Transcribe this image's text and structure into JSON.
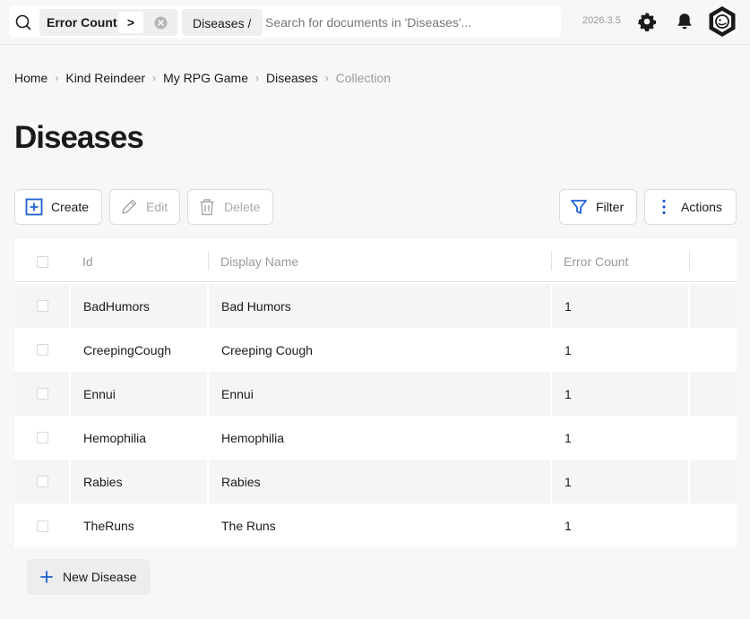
{
  "search": {
    "filter_field": "Error Count",
    "filter_operator": ">",
    "collection_chip": "Diseases /",
    "placeholder": "Search for documents in 'Diseases'..."
  },
  "header": {
    "version": "2026.3.5",
    "icons": [
      "search-icon",
      "clear-filter-icon",
      "settings-icon",
      "bell-icon",
      "avatar-icon"
    ]
  },
  "breadcrumb": [
    "Home",
    "Kind Reindeer",
    "My RPG Game",
    "Diseases",
    "Collection"
  ],
  "page_title": "Diseases",
  "toolbar": {
    "create": "Create",
    "edit": "Edit",
    "delete": "Delete",
    "filter": "Filter",
    "actions": "Actions"
  },
  "table": {
    "columns": [
      "Id",
      "Display Name",
      "Error Count"
    ],
    "rows": [
      {
        "id": "BadHumors",
        "display_name": "Bad Humors",
        "error_count": "1"
      },
      {
        "id": "CreepingCough",
        "display_name": "Creeping Cough",
        "error_count": "1"
      },
      {
        "id": "Ennui",
        "display_name": "Ennui",
        "error_count": "1"
      },
      {
        "id": "Hemophilia",
        "display_name": "Hemophilia",
        "error_count": "1"
      },
      {
        "id": "Rabies",
        "display_name": "Rabies",
        "error_count": "1"
      },
      {
        "id": "TheRuns",
        "display_name": "The Runs",
        "error_count": "1"
      }
    ]
  },
  "new_button": "New Disease",
  "colors": {
    "accent": "#1f5fd6",
    "background": "#f7f7f7",
    "row_alt": "#f5f5f5"
  }
}
